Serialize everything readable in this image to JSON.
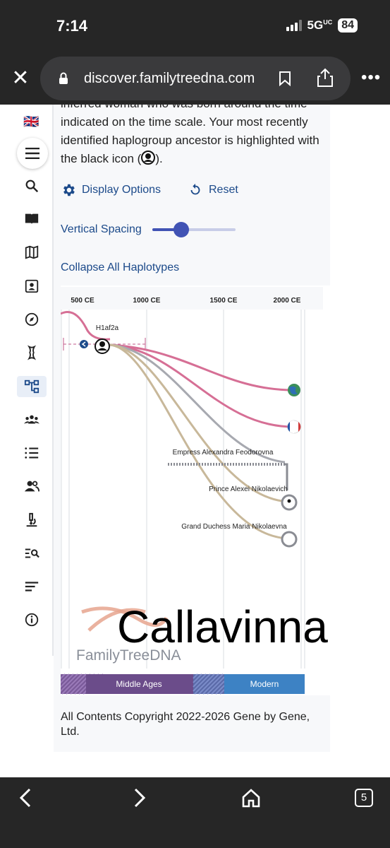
{
  "status": {
    "time": "7:14",
    "network": "5G",
    "network_sup": "UC",
    "battery": "84"
  },
  "browser": {
    "url": "discover.familytreedna.com",
    "tab_count": "5"
  },
  "sidebar": {
    "flag": "🇬🇧",
    "items": [
      "search-icon",
      "book-icon",
      "map-icon",
      "profile-icon",
      "compass-icon",
      "chromosome-icon",
      "tree-icon",
      "group-icon",
      "list-icon",
      "people-icon",
      "microscope-icon",
      "search-list-icon",
      "sort-icon",
      "info-icon"
    ]
  },
  "main": {
    "description_before": "inferred woman who was born around the time indicated on the time scale. Your most recently identified haplogroup ancestor is highlighted with the black icon (",
    "description_after": ").",
    "display_options": "Display Options",
    "reset": "Reset",
    "vertical_spacing": "Vertical Spacing",
    "vertical_spacing_level": 0.35,
    "collapse_all": "Collapse All Haplotypes",
    "copyright": "All Contents Copyright 2022-2026 Gene by Gene, Ltd."
  },
  "chart_data": {
    "type": "tree",
    "x_ticks": [
      "500 CE",
      "1000 CE",
      "1500 CE",
      "2000 CE"
    ],
    "haplogroup": "H1af2a",
    "branches": [
      {
        "label": "",
        "end_icon": "globe",
        "color": "#d66f95"
      },
      {
        "label": "",
        "end_icon": "france-flag",
        "color": "#d66f95"
      },
      {
        "label": "Empress Alexandra Feodorovna",
        "color": "#a7a9b0"
      },
      {
        "label": "Prince Alexei Nikolaevich",
        "color": "#c8b89a"
      },
      {
        "label": "Grand Duchess Maria Nikolaevna",
        "color": "#c8b89a"
      }
    ],
    "eras": [
      {
        "label": "Middle Ages",
        "color": "#6b4c8a"
      },
      {
        "label": "Modern",
        "color": "#3d82c4"
      }
    ],
    "watermark_logo": "FamilyTreeDNA",
    "watermark_text": "Callavinna"
  }
}
